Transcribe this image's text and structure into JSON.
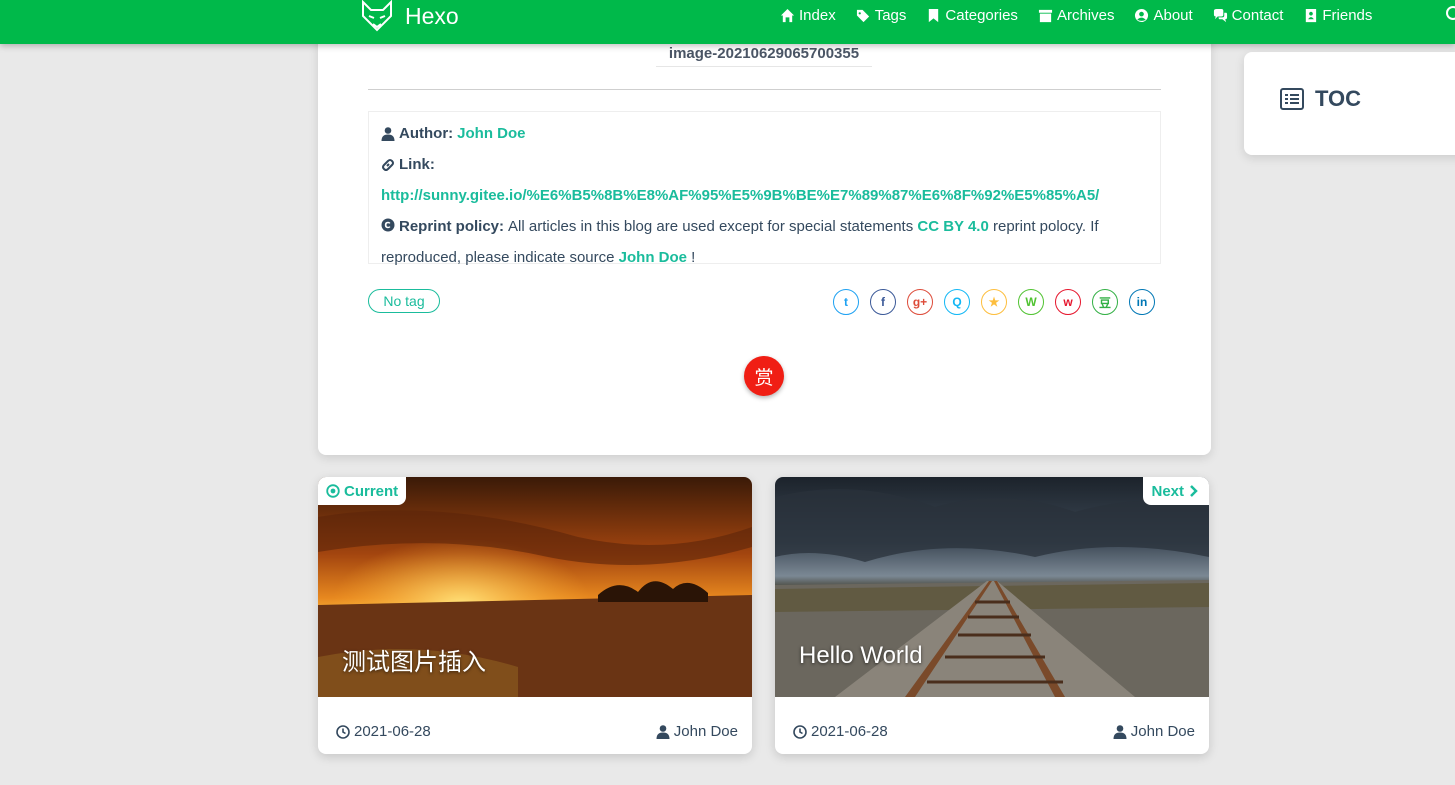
{
  "nav": {
    "brand": "Hexo",
    "items": [
      {
        "label": "Index",
        "icon": "home-icon"
      },
      {
        "label": "Tags",
        "icon": "tags-icon"
      },
      {
        "label": "Categories",
        "icon": "bookmark-icon"
      },
      {
        "label": "Archives",
        "icon": "archive-icon"
      },
      {
        "label": "About",
        "icon": "user-circle-icon"
      },
      {
        "label": "Contact",
        "icon": "comments-icon"
      },
      {
        "label": "Friends",
        "icon": "address-book-icon"
      }
    ]
  },
  "article": {
    "image_caption": "image-20210629065700355",
    "copyright": {
      "author_label": "Author:",
      "author": "John Doe",
      "link_label": "Link:",
      "link": "http://sunny.gitee.io/%E6%B5%8B%E8%AF%95%E5%9B%BE%E7%89%87%E6%8F%92%E5%85%A5/",
      "policy_label": "Reprint policy:",
      "policy_text_1": "All articles in this blog are used except for special statements",
      "policy_license": "CC BY 4.0",
      "policy_text_2": "reprint polocy. If reproduced, please indicate source",
      "policy_source": "John Doe",
      "policy_end": "!"
    },
    "tag": "No tag",
    "shares": [
      {
        "name": "twitter",
        "glyph": "t",
        "color": "#1da1f2"
      },
      {
        "name": "facebook",
        "glyph": "f",
        "color": "#3b5998"
      },
      {
        "name": "google-plus",
        "glyph": "g+",
        "color": "#dd4b39"
      },
      {
        "name": "qq",
        "glyph": "Q",
        "color": "#12b7f5"
      },
      {
        "name": "qzone",
        "glyph": "★",
        "color": "#fdbe3d"
      },
      {
        "name": "wechat",
        "glyph": "W",
        "color": "#51c332"
      },
      {
        "name": "weibo",
        "glyph": "w",
        "color": "#e6162d"
      },
      {
        "name": "douban",
        "glyph": "豆",
        "color": "#33b045"
      },
      {
        "name": "linkedin",
        "glyph": "in",
        "color": "#0077b5"
      }
    ],
    "reward": "赏"
  },
  "toc": {
    "title": "TOC"
  },
  "posts": {
    "current": {
      "badge": "Current",
      "title": "测试图片插入",
      "date": "2021-06-28",
      "author": "John Doe"
    },
    "next": {
      "badge": "Next",
      "title": "Hello World",
      "date": "2021-06-28",
      "author": "John Doe"
    }
  },
  "colors": {
    "nav": "#00b94a",
    "accent": "#1abc9c",
    "reward": "#f01e14"
  }
}
